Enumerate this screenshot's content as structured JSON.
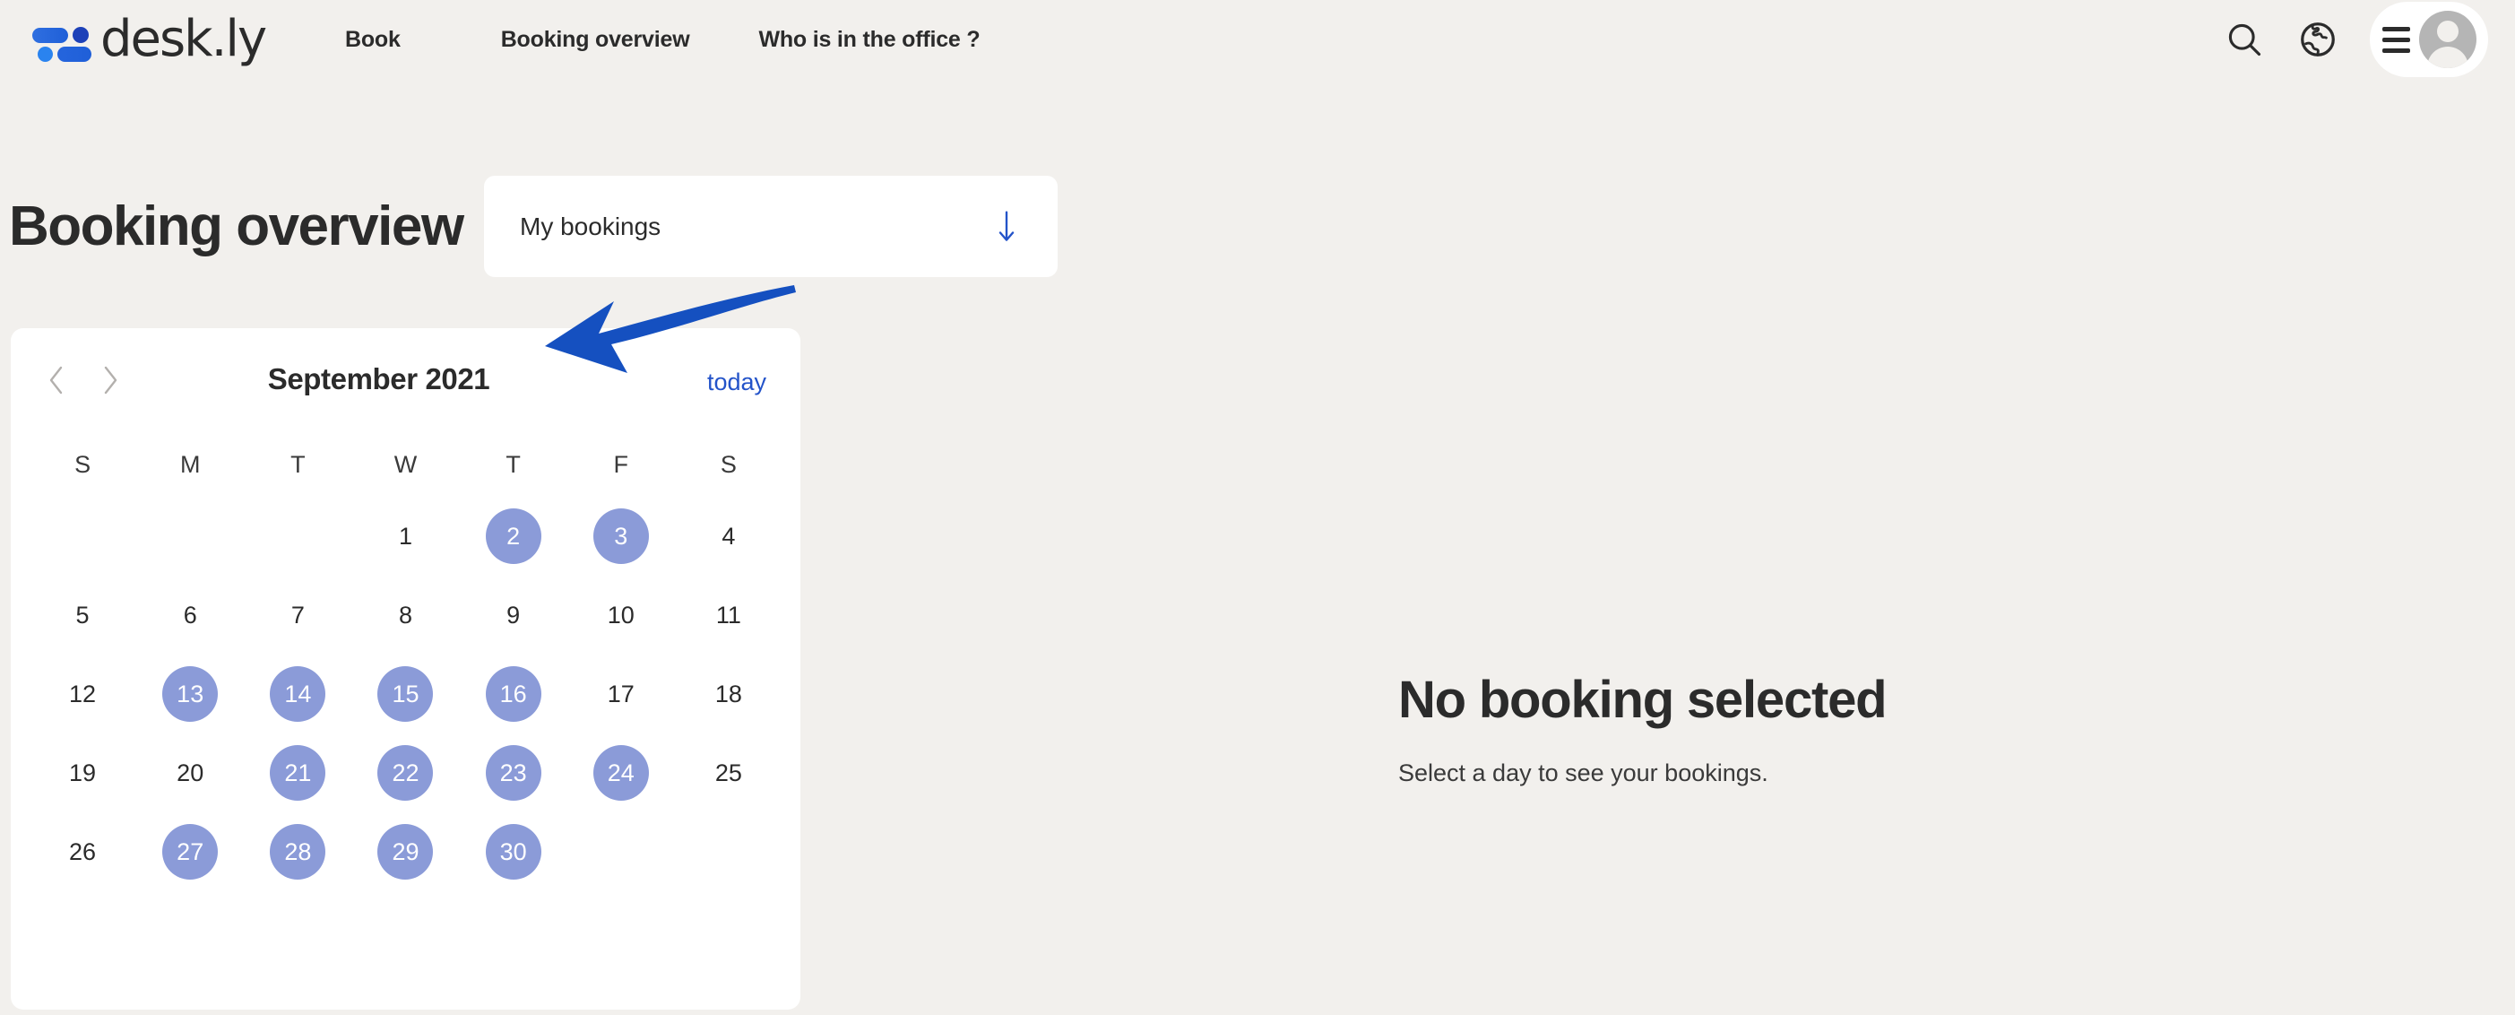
{
  "brand": {
    "name": "desk.ly",
    "logo_icon": "desk-ly-logo-icon",
    "accent_blue": "#1f5fd8"
  },
  "navbar": {
    "links": [
      {
        "label": "Book"
      },
      {
        "label": "Booking overview"
      },
      {
        "label": "Who is in the office ?"
      }
    ],
    "search_icon": "search-icon",
    "globe_icon": "globe-icon",
    "menu_icon": "hamburger-menu-icon",
    "avatar_icon": "user-avatar-icon"
  },
  "header": {
    "title": "Booking overview",
    "dropdown": {
      "value": "My bookings",
      "arrow_icon": "arrow-down-icon",
      "arrow_color": "#2353c9"
    }
  },
  "calendar": {
    "prev_icon": "chevron-left-icon",
    "next_icon": "chevron-right-icon",
    "month_label": "September 2021",
    "today_label": "today",
    "weekdays": [
      "S",
      "M",
      "T",
      "W",
      "T",
      "F",
      "S"
    ],
    "booked_color": "#8b9bd8",
    "weeks": [
      [
        {
          "day": "",
          "booked": false,
          "empty": true
        },
        {
          "day": "",
          "booked": false,
          "empty": true
        },
        {
          "day": "",
          "booked": false,
          "empty": true
        },
        {
          "day": "1",
          "booked": false,
          "empty": false
        },
        {
          "day": "2",
          "booked": true,
          "empty": false
        },
        {
          "day": "3",
          "booked": true,
          "empty": false
        },
        {
          "day": "4",
          "booked": false,
          "empty": false
        }
      ],
      [
        {
          "day": "5",
          "booked": false,
          "empty": false
        },
        {
          "day": "6",
          "booked": false,
          "empty": false
        },
        {
          "day": "7",
          "booked": false,
          "empty": false
        },
        {
          "day": "8",
          "booked": false,
          "empty": false
        },
        {
          "day": "9",
          "booked": false,
          "empty": false
        },
        {
          "day": "10",
          "booked": false,
          "empty": false
        },
        {
          "day": "11",
          "booked": false,
          "empty": false
        }
      ],
      [
        {
          "day": "12",
          "booked": false,
          "empty": false
        },
        {
          "day": "13",
          "booked": true,
          "empty": false
        },
        {
          "day": "14",
          "booked": true,
          "empty": false
        },
        {
          "day": "15",
          "booked": true,
          "empty": false
        },
        {
          "day": "16",
          "booked": true,
          "empty": false
        },
        {
          "day": "17",
          "booked": false,
          "empty": false
        },
        {
          "day": "18",
          "booked": false,
          "empty": false
        }
      ],
      [
        {
          "day": "19",
          "booked": false,
          "empty": false
        },
        {
          "day": "20",
          "booked": false,
          "empty": false
        },
        {
          "day": "21",
          "booked": true,
          "empty": false
        },
        {
          "day": "22",
          "booked": true,
          "empty": false
        },
        {
          "day": "23",
          "booked": true,
          "empty": false
        },
        {
          "day": "24",
          "booked": true,
          "empty": false
        },
        {
          "day": "25",
          "booked": false,
          "empty": false
        }
      ],
      [
        {
          "day": "26",
          "booked": false,
          "empty": false
        },
        {
          "day": "27",
          "booked": true,
          "empty": false
        },
        {
          "day": "28",
          "booked": true,
          "empty": false
        },
        {
          "day": "29",
          "booked": true,
          "empty": false
        },
        {
          "day": "30",
          "booked": true,
          "empty": false
        },
        {
          "day": "",
          "booked": false,
          "empty": true
        },
        {
          "day": "",
          "booked": false,
          "empty": true
        }
      ]
    ]
  },
  "detail": {
    "title": "No booking selected",
    "subtitle": "Select a day to see your bookings."
  },
  "annotation": {
    "arrow_icon": "annotation-arrow-icon",
    "color": "#1550c0",
    "points_at": "September 2021"
  }
}
